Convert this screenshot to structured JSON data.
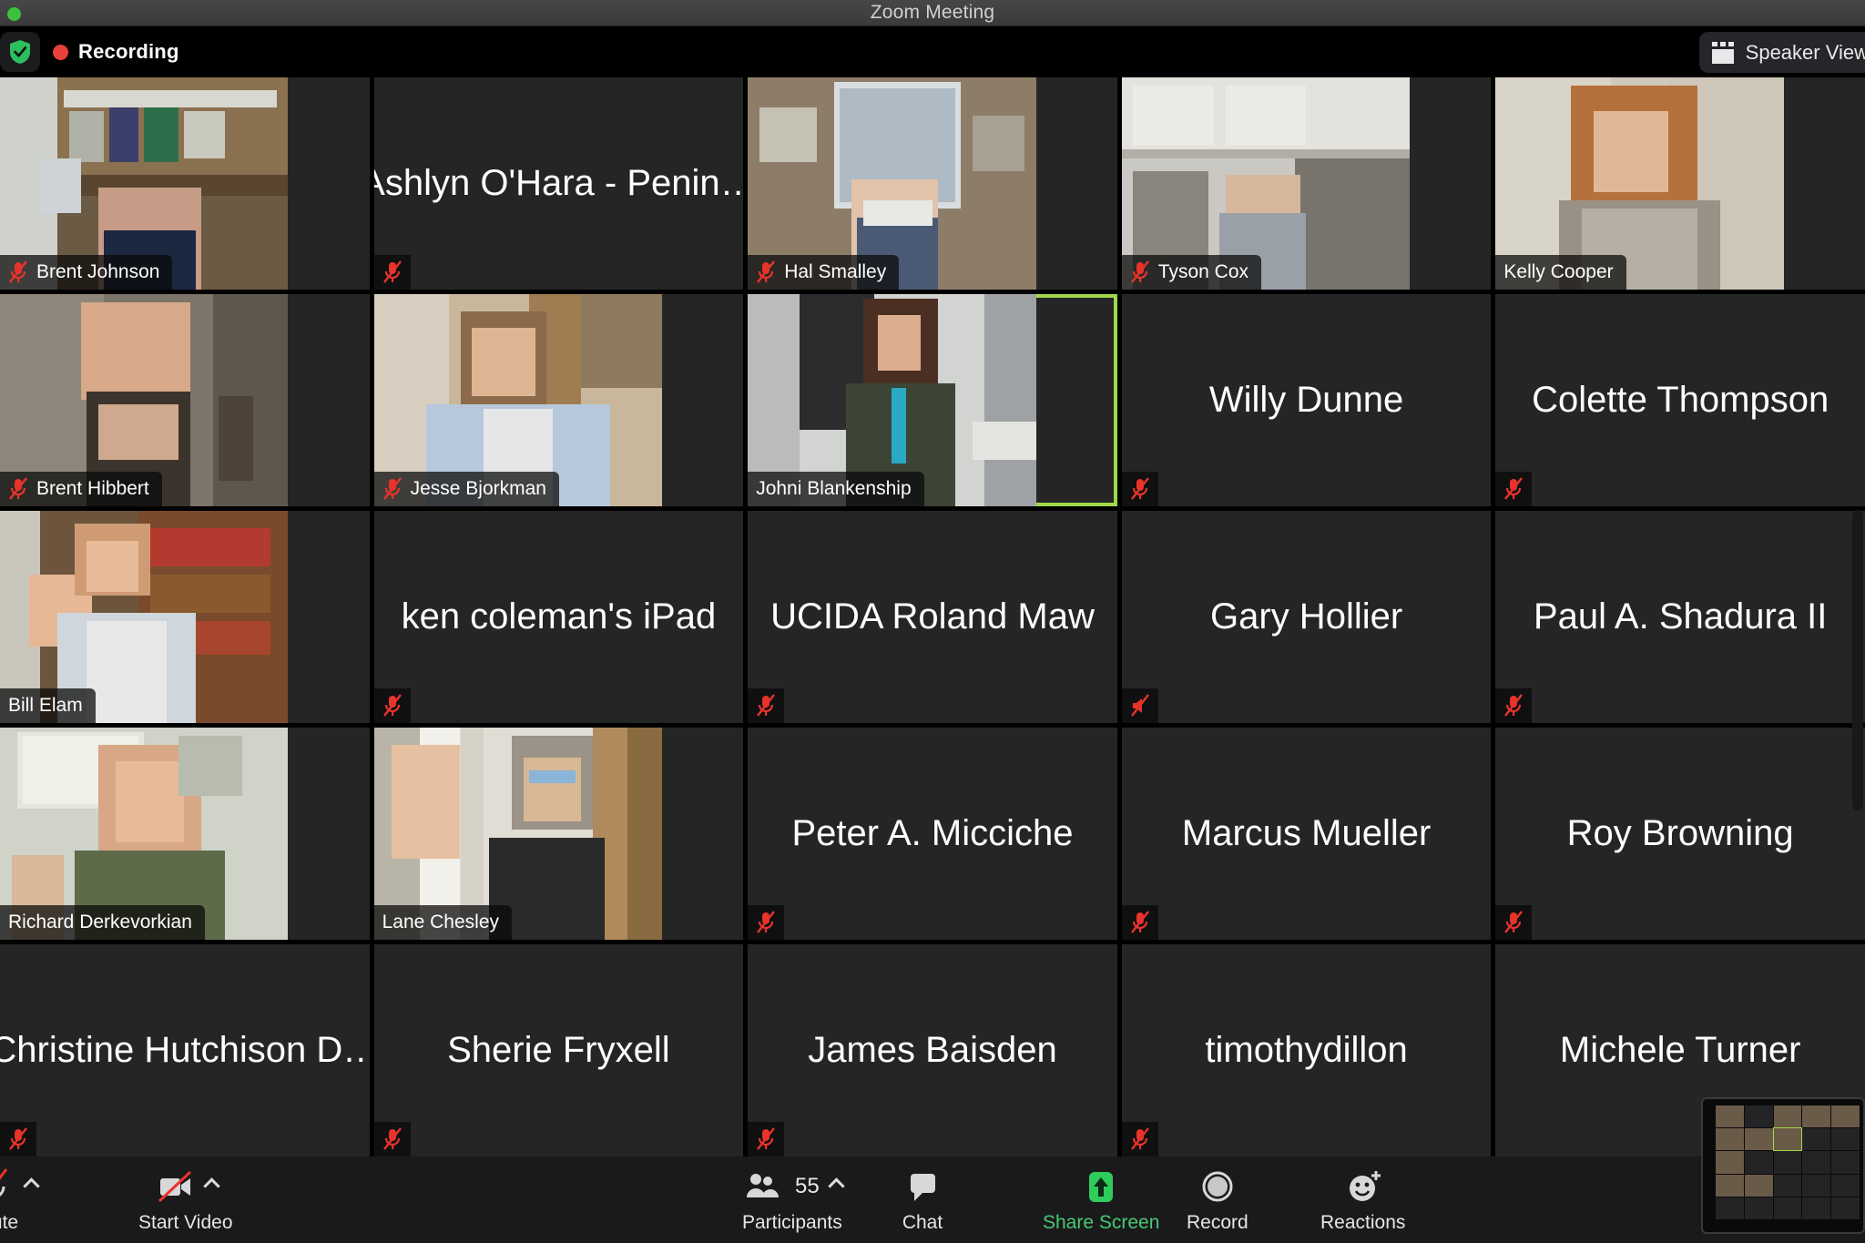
{
  "window": {
    "title": "Zoom Meeting",
    "traffic_lights": [
      "green"
    ]
  },
  "topbar": {
    "shield_icon": "security-shield-check-icon",
    "recording_label": "Recording",
    "recording_dot_color": "#e8413a",
    "view_button": {
      "label": "Speaker View",
      "icon": "grid-view-icon"
    }
  },
  "gallery": {
    "columns": 5,
    "rows": 5,
    "active_speaker": "Johni Blankenship",
    "active_border_color": "#9fd84a",
    "participants": [
      {
        "name": "Brent Johnson",
        "video": true,
        "muted": true,
        "scene": "office-bookshelf",
        "label_style": "bar"
      },
      {
        "name": "Ashlyn O'Hara - Penin…",
        "video": false,
        "muted": true,
        "scene": "",
        "label_style": "center"
      },
      {
        "name": "Hal Smalley",
        "video": true,
        "muted": true,
        "scene": "window-room",
        "label_style": "bar"
      },
      {
        "name": "Tyson Cox",
        "video": true,
        "muted": true,
        "scene": "kitchen-cabinets",
        "label_style": "bar"
      },
      {
        "name": "Kelly Cooper",
        "video": true,
        "muted": false,
        "scene": "woman-red-hair",
        "label_style": "bar"
      },
      {
        "name": "Brent Hibbert",
        "video": true,
        "muted": true,
        "scene": "dark-room-man",
        "label_style": "bar"
      },
      {
        "name": "Jesse Bjorkman",
        "video": true,
        "muted": true,
        "scene": "plaid-shirt-man",
        "label_style": "bar"
      },
      {
        "name": "Johni Blankenship",
        "video": true,
        "muted": false,
        "scene": "woman-podium",
        "label_style": "bar",
        "active": true
      },
      {
        "name": "Willy Dunne",
        "video": false,
        "muted": true,
        "scene": "",
        "label_style": "center"
      },
      {
        "name": "Colette Thompson",
        "video": false,
        "muted": true,
        "scene": "",
        "label_style": "center"
      },
      {
        "name": "Bill Elam",
        "video": true,
        "muted": false,
        "scene": "library-hand-up",
        "label_style": "bar"
      },
      {
        "name": "ken coleman's iPad",
        "video": false,
        "muted": true,
        "scene": "",
        "label_style": "center"
      },
      {
        "name": "UCIDA Roland Maw",
        "video": false,
        "muted": true,
        "scene": "",
        "label_style": "center"
      },
      {
        "name": "Gary Hollier",
        "video": false,
        "muted": true,
        "scene": "",
        "label_style": "center",
        "mic_variant": "no-audio"
      },
      {
        "name": "Paul A. Shadura II",
        "video": false,
        "muted": true,
        "scene": "",
        "label_style": "center"
      },
      {
        "name": "Richard Derkevorkian",
        "video": true,
        "muted": false,
        "scene": "home-sign-man",
        "label_style": "bar"
      },
      {
        "name": "Lane Chesley",
        "video": true,
        "muted": false,
        "scene": "blinds-hand-up",
        "label_style": "bar"
      },
      {
        "name": "Peter A. Micciche",
        "video": false,
        "muted": true,
        "scene": "",
        "label_style": "center"
      },
      {
        "name": "Marcus Mueller",
        "video": false,
        "muted": true,
        "scene": "",
        "label_style": "center"
      },
      {
        "name": "Roy Browning",
        "video": false,
        "muted": true,
        "scene": "",
        "label_style": "center"
      },
      {
        "name": "Christine Hutchison D…",
        "video": false,
        "muted": true,
        "scene": "",
        "label_style": "center"
      },
      {
        "name": "Sherie Fryxell",
        "video": false,
        "muted": true,
        "scene": "",
        "label_style": "center"
      },
      {
        "name": "James Baisden",
        "video": false,
        "muted": true,
        "scene": "",
        "label_style": "center"
      },
      {
        "name": "timothydillon",
        "video": false,
        "muted": true,
        "scene": "",
        "label_style": "center"
      },
      {
        "name": "Michele Turner",
        "video": false,
        "muted": false,
        "scene": "",
        "label_style": "center"
      }
    ]
  },
  "toolbar": {
    "items": [
      {
        "id": "mute",
        "label": "ute",
        "icon": "microphone-muted-icon",
        "caret": true,
        "accent": ""
      },
      {
        "id": "video",
        "label": "Start Video",
        "icon": "camera-off-icon",
        "caret": true,
        "accent": ""
      },
      {
        "id": "participants",
        "label": "Participants",
        "icon": "participants-icon",
        "caret": true,
        "accent": "",
        "count": "55"
      },
      {
        "id": "chat",
        "label": "Chat",
        "icon": "chat-bubble-icon",
        "caret": false,
        "accent": ""
      },
      {
        "id": "share",
        "label": "Share Screen",
        "icon": "share-screen-icon",
        "caret": false,
        "accent": "#49c972"
      },
      {
        "id": "record",
        "label": "Record",
        "icon": "record-circle-icon",
        "caret": false,
        "accent": ""
      },
      {
        "id": "reactions",
        "label": "Reactions",
        "icon": "reactions-smiley-icon",
        "caret": false,
        "accent": ""
      }
    ]
  },
  "pip": {
    "name": "meeting-preview-thumbnail"
  }
}
